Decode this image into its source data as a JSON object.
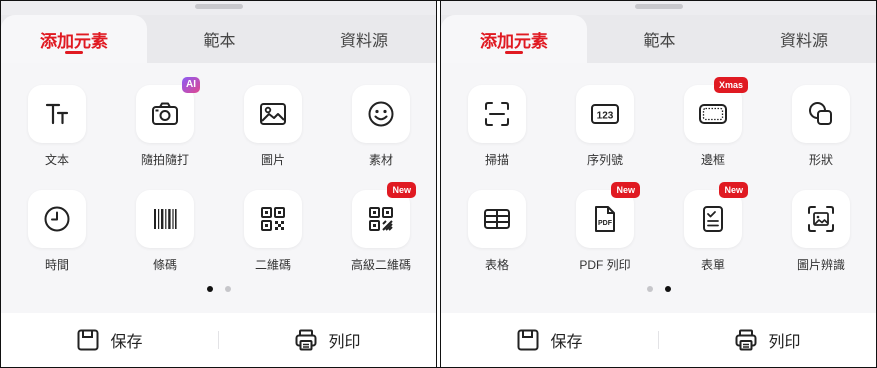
{
  "left_panel": {
    "tabs": [
      "添加元素",
      "範本",
      "資料源"
    ],
    "items": [
      {
        "icon": "text-size-icon",
        "label": "文本"
      },
      {
        "icon": "camera-icon",
        "label": "隨拍隨打",
        "badge": "AI"
      },
      {
        "icon": "image-icon",
        "label": "圖片"
      },
      {
        "icon": "smiley-icon",
        "label": "素材"
      },
      {
        "icon": "clock-icon",
        "label": "時間"
      },
      {
        "icon": "barcode-icon",
        "label": "條碼"
      },
      {
        "icon": "qr-code-icon",
        "label": "二維碼"
      },
      {
        "icon": "advanced-qr-code-icon",
        "label": "高級二維碼",
        "badge": "New"
      }
    ],
    "page_indicator": {
      "pages": 2,
      "current": 1
    },
    "bottom": {
      "save": "保存",
      "print": "列印"
    }
  },
  "right_panel": {
    "tabs": [
      "添加元素",
      "範本",
      "資料源"
    ],
    "items": [
      {
        "icon": "scan-icon",
        "label": "掃描"
      },
      {
        "icon": "serial-number-icon",
        "label": "序列號",
        "icon_text": "123"
      },
      {
        "icon": "border-frame-icon",
        "label": "邊框",
        "badge": "Xmas"
      },
      {
        "icon": "shape-icon",
        "label": "形狀"
      },
      {
        "icon": "table-icon",
        "label": "表格"
      },
      {
        "icon": "pdf-file-icon",
        "label": "PDF 列印",
        "badge": "New",
        "icon_text": "PDF"
      },
      {
        "icon": "form-icon",
        "label": "表單",
        "badge": "New"
      },
      {
        "icon": "image-recognition-icon",
        "label": "圖片辨識"
      }
    ],
    "page_indicator": {
      "pages": 2,
      "current": 2
    },
    "bottom": {
      "save": "保存",
      "print": "列印"
    }
  },
  "colors": {
    "accent": "#e01a22",
    "background": "#f6f6f8",
    "tile": "#ffffff"
  }
}
